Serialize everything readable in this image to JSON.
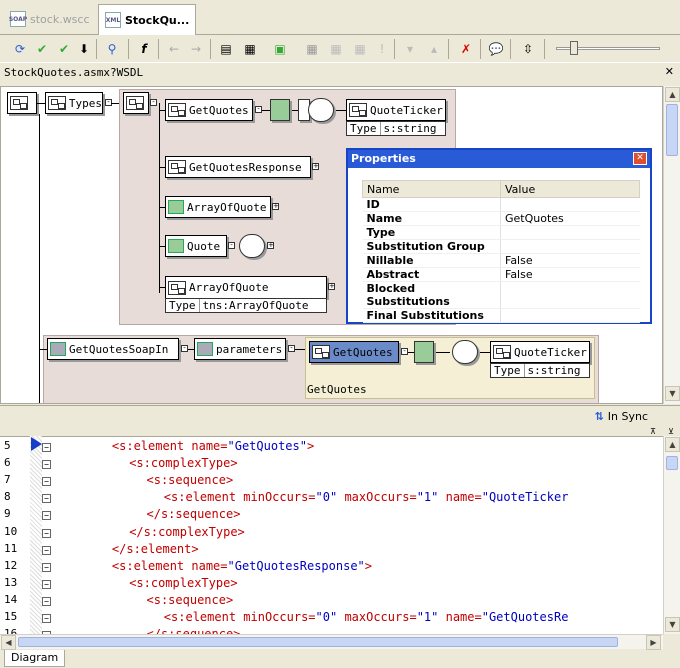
{
  "tabs": [
    {
      "label": "stock.wscc",
      "icon": "soap-file-icon",
      "active": false
    },
    {
      "label": "StockQu...",
      "icon": "xml-file-icon",
      "active": true
    }
  ],
  "address": "StockQuotes.asmx?WSDL",
  "diagram": {
    "root_nodes": [
      "Types"
    ],
    "elements": {
      "get_quotes": "GetQuotes",
      "quote_ticker": "QuoteTicker",
      "quote_ticker_type_label": "Type",
      "quote_ticker_type": "s:string",
      "get_quotes_response": "GetQuotesResponse",
      "array_of_quote_1": "ArrayOfQuote",
      "quote": "Quote",
      "array_of_quote_2": "ArrayOfQuote",
      "array_of_quote_2_type_label": "Type",
      "array_of_quote_2_type": "tns:ArrayOfQuote",
      "soap_in": "GetQuotesSoapIn",
      "parameters": "parameters",
      "get_quotes_2": "GetQuotes",
      "quote_ticker_2": "QuoteTicker",
      "quote_ticker_2_type_label": "Type",
      "quote_ticker_2_type": "s:string",
      "group_label": "GetQuotes"
    }
  },
  "properties": {
    "title": "Properties",
    "col_name": "Name",
    "col_value": "Value",
    "rows": [
      {
        "name": "ID",
        "value": ""
      },
      {
        "name": "Name",
        "value": "GetQuotes"
      },
      {
        "name": "Type",
        "value": ""
      },
      {
        "name": "Substitution Group",
        "value": ""
      },
      {
        "name": "Nillable",
        "value": "False"
      },
      {
        "name": "Abstract",
        "value": "False"
      },
      {
        "name": "Blocked Substitutions",
        "value": ""
      },
      {
        "name": "Final Substitutions",
        "value": ""
      }
    ]
  },
  "sync_label": "In Sync",
  "code_lines": [
    {
      "n": "5",
      "indent": 3,
      "parts": [
        [
          "tag",
          "<s:element "
        ],
        [
          "attr",
          "name="
        ],
        [
          "val",
          "\"GetQuotes\""
        ],
        [
          "tag",
          ">"
        ]
      ]
    },
    {
      "n": "6",
      "indent": 4,
      "parts": [
        [
          "tag",
          "<s:complexType>"
        ]
      ]
    },
    {
      "n": "7",
      "indent": 5,
      "parts": [
        [
          "tag",
          "<s:sequence>"
        ]
      ]
    },
    {
      "n": "8",
      "indent": 6,
      "parts": [
        [
          "tag",
          "<s:element "
        ],
        [
          "attr",
          "minOccurs="
        ],
        [
          "val",
          "\"0\" "
        ],
        [
          "attr",
          "maxOccurs="
        ],
        [
          "val",
          "\"1\" "
        ],
        [
          "attr",
          "name="
        ],
        [
          "val",
          "\"QuoteTicker"
        ]
      ]
    },
    {
      "n": "9",
      "indent": 5,
      "parts": [
        [
          "tag",
          "</s:sequence>"
        ]
      ]
    },
    {
      "n": "10",
      "indent": 4,
      "parts": [
        [
          "tag",
          "</s:complexType>"
        ]
      ]
    },
    {
      "n": "11",
      "indent": 3,
      "parts": [
        [
          "tag",
          "</s:element>"
        ]
      ]
    },
    {
      "n": "12",
      "indent": 3,
      "parts": [
        [
          "tag",
          "<s:element "
        ],
        [
          "attr",
          "name="
        ],
        [
          "val",
          "\"GetQuotesResponse\""
        ],
        [
          "tag",
          ">"
        ]
      ]
    },
    {
      "n": "13",
      "indent": 4,
      "parts": [
        [
          "tag",
          "<s:complexType>"
        ]
      ]
    },
    {
      "n": "14",
      "indent": 5,
      "parts": [
        [
          "tag",
          "<s:sequence>"
        ]
      ]
    },
    {
      "n": "15",
      "indent": 6,
      "parts": [
        [
          "tag",
          "<s:element "
        ],
        [
          "attr",
          "minOccurs="
        ],
        [
          "val",
          "\"0\" "
        ],
        [
          "attr",
          "maxOccurs="
        ],
        [
          "val",
          "\"1\" "
        ],
        [
          "attr",
          "name="
        ],
        [
          "val",
          "\"GetQuotesRe"
        ]
      ]
    },
    {
      "n": "16",
      "indent": 5,
      "parts": [
        [
          "tag",
          "</s:sequence>"
        ]
      ]
    }
  ],
  "bottom_tab": "Diagram"
}
